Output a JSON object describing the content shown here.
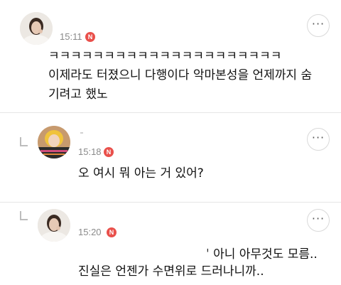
{
  "comments": [
    {
      "time": "15:11",
      "badge": "N",
      "more": "···",
      "lines": [
        "ㅋㅋㅋㅋㅋㅋㅋㅋㅋㅋㅋㅋㅋㅋㅋㅋㅋㅋㅋㅋㅋ",
        "이제라도 터졌으니 다행이다 악마본성을 언제까지 숨",
        "기려고 했노"
      ]
    },
    {
      "time": "15:18",
      "badge": "N",
      "more": "···",
      "lines": [
        "오 여시 뭐 아는 거 있어?"
      ]
    },
    {
      "time": "15:20",
      "badge": "N",
      "more": "···",
      "lines": [
        "ˈ 아니 아무것도 모름..",
        "진실은 언젠가 수면위로 드러나니까.."
      ]
    }
  ]
}
